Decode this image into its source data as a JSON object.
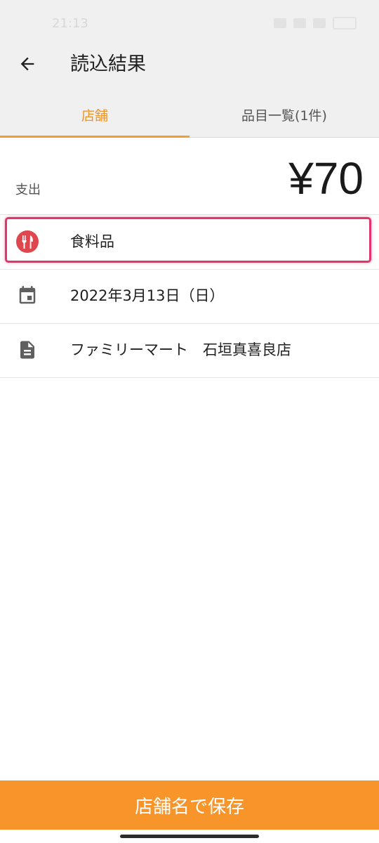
{
  "status_bar": {
    "time": "21:13"
  },
  "header": {
    "title": "読込結果",
    "back_icon": "arrow-left-icon"
  },
  "tabs": [
    {
      "label": "店舗",
      "active": true
    },
    {
      "label": "品目一覧(1件)",
      "active": false
    }
  ],
  "summary": {
    "type_label": "支出",
    "amount": "¥70"
  },
  "details": {
    "category": {
      "label": "食料品",
      "icon": "fork-knife-icon",
      "icon_color": "#e0464e"
    },
    "date": {
      "label": "2022年3月13日（日）",
      "icon": "calendar-icon"
    },
    "store": {
      "label": "ファミリーマート　石垣真喜良店",
      "icon": "document-icon"
    }
  },
  "footer": {
    "save_label": "店舗名で保存"
  },
  "colors": {
    "accent": "#f7952a",
    "highlight": "#e0366c",
    "app_bar": "#f0f0f0"
  }
}
